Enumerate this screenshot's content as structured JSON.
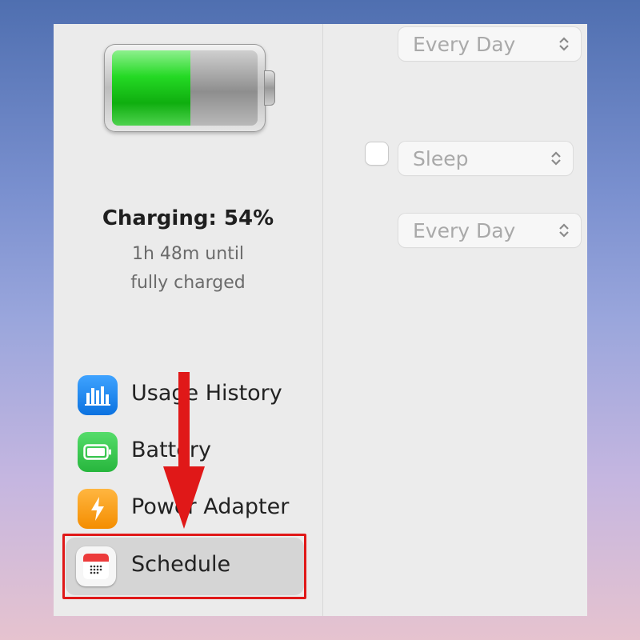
{
  "battery": {
    "level_percent": 54,
    "fill_color": "#22d322"
  },
  "status": {
    "title": "Charging: 54%",
    "line1": "1h 48m until",
    "line2": "fully charged"
  },
  "sidebar": {
    "items": [
      {
        "label": "Usage History",
        "icon": "bar-chart-icon"
      },
      {
        "label": "Battery",
        "icon": "battery-icon"
      },
      {
        "label": "Power Adapter",
        "icon": "lightning-icon"
      },
      {
        "label": "Schedule",
        "icon": "calendar-icon",
        "selected": true
      }
    ]
  },
  "schedule": {
    "popup1": "Every Day",
    "action_popup": "Sleep",
    "action_checked": false,
    "popup2": "Every Day"
  },
  "annotation": {
    "color": "#e01818"
  }
}
